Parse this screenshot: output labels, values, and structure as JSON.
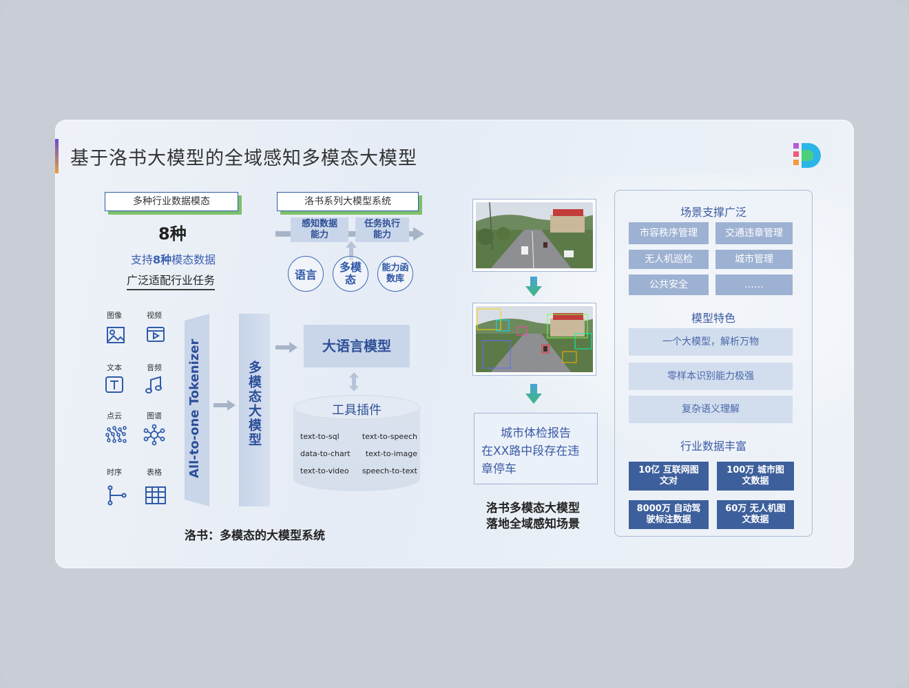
{
  "slide": {
    "title": "基于洛书大模型的全域感知多模态大模型"
  },
  "left": {
    "data_modal_header": "多种行业数据模态",
    "count": "8种",
    "support_prefix": "支持",
    "support_bold": "8种",
    "support_suffix": "模态数据",
    "adapt_text": "广泛适配行业任务",
    "modalities": [
      {
        "label": "图像",
        "icon": "image-icon"
      },
      {
        "label": "视频",
        "icon": "video-icon"
      },
      {
        "label": "文本",
        "icon": "text-icon"
      },
      {
        "label": "音频",
        "icon": "audio-icon"
      },
      {
        "label": "点云",
        "icon": "pointcloud-icon"
      },
      {
        "label": "图谱",
        "icon": "graph-icon"
      },
      {
        "label": "时序",
        "icon": "timeseries-icon"
      },
      {
        "label": "表格",
        "icon": "table-icon"
      }
    ],
    "tokenizer": "All-to-one Tokenizer",
    "mm_model": "多模态大模型",
    "caption": "洛书：多模态的大模型系统"
  },
  "system": {
    "header": "洛书系列大模型系统",
    "perceive": "感知数据能力",
    "perceive_l1": "感知数据",
    "perceive_l2": "能力",
    "execute_l1": "任务执行",
    "execute_l2": "能力",
    "circles": [
      {
        "l1": "语言",
        "l2": ""
      },
      {
        "l1": "多模",
        "l2": "态"
      },
      {
        "l1": "能力函",
        "l2": "数库"
      }
    ],
    "llm": "大语言模型",
    "tools_title": "工具插件",
    "tools": [
      [
        "text-to-sql",
        "text-to-speech"
      ],
      [
        "data-to-chart",
        "text-to-image"
      ],
      [
        "text-to-video",
        "speech-to-text"
      ]
    ]
  },
  "scene": {
    "report_title": "城市体检报告",
    "report_body": "在XX路中段存在违章停车",
    "caption_l1": "洛书多模态大模型",
    "caption_l2": "落地全域感知场景"
  },
  "panel": {
    "scenes_title": "场景支撑广泛",
    "scenes": [
      "市容秩序管理",
      "交通违章管理",
      "无人机巡检",
      "城市管理",
      "公共安全",
      "……"
    ],
    "features_title": "模型特色",
    "features": [
      "一个大模型，解析万物",
      "零样本识别能力极强",
      "复杂语义理解"
    ],
    "data_title": "行业数据丰富",
    "data": [
      {
        "l1": "10亿 互联网图",
        "l2": "文对"
      },
      {
        "l1": "100万 城市图",
        "l2": "文数据"
      },
      {
        "l1": "8000万 自动驾",
        "l2": "驶标注数据"
      },
      {
        "l1": "60万 无人机图",
        "l2": "文数据"
      }
    ]
  },
  "colors": {
    "accent_blue": "#2e56a6",
    "accent_green": "#7dc06b",
    "dark_blue_box": "#3d5f9c",
    "tag_blue": "#9db1d2"
  }
}
